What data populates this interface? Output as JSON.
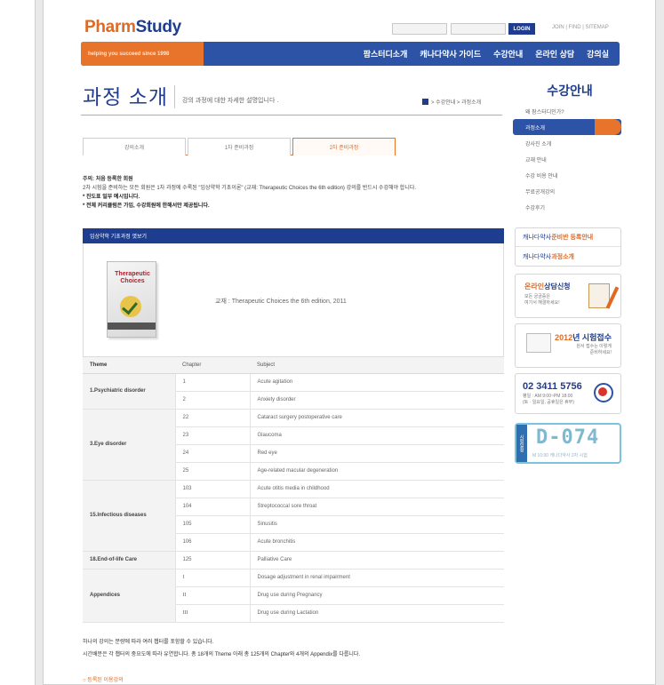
{
  "header": {
    "logo_part1": "Pharm",
    "logo_part2": "Study",
    "login_label": "LOGIN",
    "util_links": "JOIN | FIND | SITEMAP",
    "tagline": "helping you succeed since 1998",
    "nav": [
      "팜스터디소개",
      "캐나다약사 가이드",
      "수강안내",
      "온라인 상담",
      "강의실"
    ]
  },
  "title_area": {
    "title": "과정 소개",
    "subtitle": "강의 과정에 대한 자세한 설명입니다 .",
    "breadcrumb": "> 수강안내 > 과정소개"
  },
  "tabs": [
    "강의소개",
    "1차 준비과정",
    "2차 준비과정"
  ],
  "active_tab": 2,
  "notice": {
    "line1": "주의: 처음 등록한 회원",
    "line2": "2차 시험을 준비하는 모든 회원은 1차 과정에 수록된 \"임상약학 기초이론\" (교재: Therapeutic Choices the 6th edition) 강의를 반드시 수강해야 합니다.",
    "line3": "* 진도표 일부 예시입니다.",
    "line4": "* 전체 커리큘럼은 가입, 수강회원에 한해서만 제공됩니다."
  },
  "course": {
    "header": "임상약학 기초과정 엿보기",
    "book_title": "Therapeutic Choices",
    "text": "교재 : Therapeutic Choices the 6th edition, 2011"
  },
  "table": {
    "headers": [
      "Theme",
      "Chapter",
      "Subject"
    ],
    "groups": [
      {
        "theme": "1.Psychiatric disorder",
        "rows": [
          [
            "1",
            "Acute agitation"
          ],
          [
            "2",
            "Anxiety disorder"
          ]
        ]
      },
      {
        "theme": "3.Eye disorder",
        "rows": [
          [
            "22",
            "Cataract surgery postoperative care"
          ],
          [
            "23",
            "Glaucoma"
          ],
          [
            "24",
            "Red eye"
          ],
          [
            "25",
            "Age-related macular degeneration"
          ]
        ]
      },
      {
        "theme": "15.Infectious diseases",
        "rows": [
          [
            "103",
            "Acute otitis media in childhood"
          ],
          [
            "104",
            "Streptococcal sore throat"
          ],
          [
            "105",
            "Sinusitis"
          ],
          [
            "106",
            "Acute bronchitis"
          ]
        ]
      },
      {
        "theme": "18.End-of-life Care",
        "rows": [
          [
            "125",
            "Palliative Care"
          ]
        ]
      },
      {
        "theme": "Appendices",
        "rows": [
          [
            "I",
            "Dosage adjustment in renal impairment"
          ],
          [
            "II",
            "Drug use during Pregnancy"
          ],
          [
            "III",
            "Drug use during Lactation"
          ]
        ]
      }
    ]
  },
  "footnote": {
    "line1": "하나의 강의는 분량에 따라 여러 챕터를 포함할 수 있습니다.",
    "line2": "시간배분은 각 챕터의 중요도에 따라 유연합니다. 총 18개의 Theme 아래 총 125개의 Chapter와 4개의 Appendix를 다룹니다.",
    "more_link": "등록된 이용강의"
  },
  "sidebar": {
    "title": "수강안내",
    "items": [
      "왜 팜스터디인가?",
      "과정소개",
      "강사진 소개",
      "교재 안내",
      "수강 비용 안내",
      "무료공개강의",
      "수강후기"
    ],
    "active_item": 1,
    "link1_em": "캐나다약사",
    "link1_rest": " 준비반 등록안내",
    "link2_norm": "캐나다약사 ",
    "link2_em": "과정소개",
    "consult_orange": "온라인",
    "consult_blue": "상담신청",
    "consult_sub1": "모든 궁금증은",
    "consult_sub2": "여기서 해결하세요!",
    "exam_year": "2012",
    "exam_rest": "년 시험접수",
    "exam_sub1": "원서 접수는 이렇게",
    "exam_sub2": "준비하세요!",
    "phone": "02 3411 5756",
    "phone_sub1": "평일 : AM 9:00~PM 18:00",
    "phone_sub2": "(토 · 일요일, 공휴일은 휴무)",
    "dday_tab": "시험일정",
    "dday_count": "D-074",
    "dday_sub": "M 10:00 캐나다약사 2차 시험"
  },
  "colors": {
    "brand_blue": "#1f3d8f",
    "brand_orange": "#e06a23",
    "nav_blue": "#2d53a6"
  }
}
